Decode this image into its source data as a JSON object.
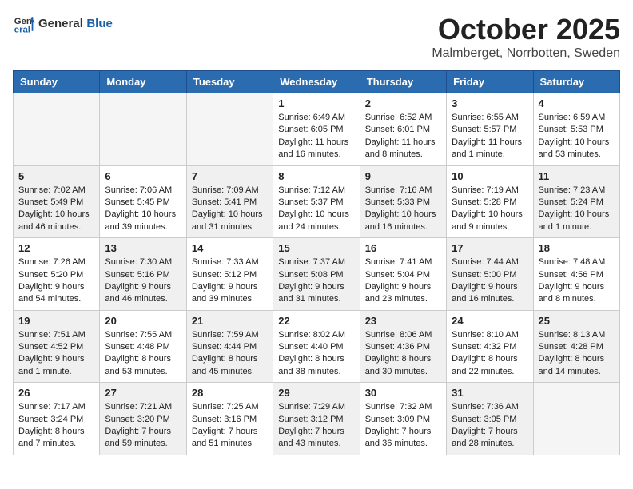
{
  "logo": {
    "general": "General",
    "blue": "Blue"
  },
  "header": {
    "month": "October 2025",
    "location": "Malmberget, Norrbotten, Sweden"
  },
  "weekdays": [
    "Sunday",
    "Monday",
    "Tuesday",
    "Wednesday",
    "Thursday",
    "Friday",
    "Saturday"
  ],
  "weeks": [
    [
      {
        "day": "",
        "info": "",
        "empty": true
      },
      {
        "day": "",
        "info": "",
        "empty": true
      },
      {
        "day": "",
        "info": "",
        "empty": true
      },
      {
        "day": "1",
        "info": "Sunrise: 6:49 AM\nSunset: 6:05 PM\nDaylight: 11 hours\nand 16 minutes."
      },
      {
        "day": "2",
        "info": "Sunrise: 6:52 AM\nSunset: 6:01 PM\nDaylight: 11 hours\nand 8 minutes."
      },
      {
        "day": "3",
        "info": "Sunrise: 6:55 AM\nSunset: 5:57 PM\nDaylight: 11 hours\nand 1 minute."
      },
      {
        "day": "4",
        "info": "Sunrise: 6:59 AM\nSunset: 5:53 PM\nDaylight: 10 hours\nand 53 minutes."
      }
    ],
    [
      {
        "day": "5",
        "info": "Sunrise: 7:02 AM\nSunset: 5:49 PM\nDaylight: 10 hours\nand 46 minutes.",
        "shaded": true
      },
      {
        "day": "6",
        "info": "Sunrise: 7:06 AM\nSunset: 5:45 PM\nDaylight: 10 hours\nand 39 minutes."
      },
      {
        "day": "7",
        "info": "Sunrise: 7:09 AM\nSunset: 5:41 PM\nDaylight: 10 hours\nand 31 minutes.",
        "shaded": true
      },
      {
        "day": "8",
        "info": "Sunrise: 7:12 AM\nSunset: 5:37 PM\nDaylight: 10 hours\nand 24 minutes."
      },
      {
        "day": "9",
        "info": "Sunrise: 7:16 AM\nSunset: 5:33 PM\nDaylight: 10 hours\nand 16 minutes.",
        "shaded": true
      },
      {
        "day": "10",
        "info": "Sunrise: 7:19 AM\nSunset: 5:28 PM\nDaylight: 10 hours\nand 9 minutes."
      },
      {
        "day": "11",
        "info": "Sunrise: 7:23 AM\nSunset: 5:24 PM\nDaylight: 10 hours\nand 1 minute.",
        "shaded": true
      }
    ],
    [
      {
        "day": "12",
        "info": "Sunrise: 7:26 AM\nSunset: 5:20 PM\nDaylight: 9 hours\nand 54 minutes."
      },
      {
        "day": "13",
        "info": "Sunrise: 7:30 AM\nSunset: 5:16 PM\nDaylight: 9 hours\nand 46 minutes.",
        "shaded": true
      },
      {
        "day": "14",
        "info": "Sunrise: 7:33 AM\nSunset: 5:12 PM\nDaylight: 9 hours\nand 39 minutes."
      },
      {
        "day": "15",
        "info": "Sunrise: 7:37 AM\nSunset: 5:08 PM\nDaylight: 9 hours\nand 31 minutes.",
        "shaded": true
      },
      {
        "day": "16",
        "info": "Sunrise: 7:41 AM\nSunset: 5:04 PM\nDaylight: 9 hours\nand 23 minutes."
      },
      {
        "day": "17",
        "info": "Sunrise: 7:44 AM\nSunset: 5:00 PM\nDaylight: 9 hours\nand 16 minutes.",
        "shaded": true
      },
      {
        "day": "18",
        "info": "Sunrise: 7:48 AM\nSunset: 4:56 PM\nDaylight: 9 hours\nand 8 minutes."
      }
    ],
    [
      {
        "day": "19",
        "info": "Sunrise: 7:51 AM\nSunset: 4:52 PM\nDaylight: 9 hours\nand 1 minute.",
        "shaded": true
      },
      {
        "day": "20",
        "info": "Sunrise: 7:55 AM\nSunset: 4:48 PM\nDaylight: 8 hours\nand 53 minutes."
      },
      {
        "day": "21",
        "info": "Sunrise: 7:59 AM\nSunset: 4:44 PM\nDaylight: 8 hours\nand 45 minutes.",
        "shaded": true
      },
      {
        "day": "22",
        "info": "Sunrise: 8:02 AM\nSunset: 4:40 PM\nDaylight: 8 hours\nand 38 minutes."
      },
      {
        "day": "23",
        "info": "Sunrise: 8:06 AM\nSunset: 4:36 PM\nDaylight: 8 hours\nand 30 minutes.",
        "shaded": true
      },
      {
        "day": "24",
        "info": "Sunrise: 8:10 AM\nSunset: 4:32 PM\nDaylight: 8 hours\nand 22 minutes."
      },
      {
        "day": "25",
        "info": "Sunrise: 8:13 AM\nSunset: 4:28 PM\nDaylight: 8 hours\nand 14 minutes.",
        "shaded": true
      }
    ],
    [
      {
        "day": "26",
        "info": "Sunrise: 7:17 AM\nSunset: 3:24 PM\nDaylight: 8 hours\nand 7 minutes."
      },
      {
        "day": "27",
        "info": "Sunrise: 7:21 AM\nSunset: 3:20 PM\nDaylight: 7 hours\nand 59 minutes.",
        "shaded": true
      },
      {
        "day": "28",
        "info": "Sunrise: 7:25 AM\nSunset: 3:16 PM\nDaylight: 7 hours\nand 51 minutes."
      },
      {
        "day": "29",
        "info": "Sunrise: 7:29 AM\nSunset: 3:12 PM\nDaylight: 7 hours\nand 43 minutes.",
        "shaded": true
      },
      {
        "day": "30",
        "info": "Sunrise: 7:32 AM\nSunset: 3:09 PM\nDaylight: 7 hours\nand 36 minutes."
      },
      {
        "day": "31",
        "info": "Sunrise: 7:36 AM\nSunset: 3:05 PM\nDaylight: 7 hours\nand 28 minutes.",
        "shaded": true
      },
      {
        "day": "",
        "info": "",
        "empty": true
      }
    ]
  ]
}
